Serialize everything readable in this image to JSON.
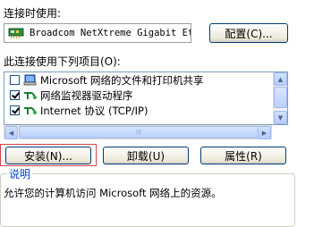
{
  "connect_using": {
    "label": "连接时使用:",
    "adapter_name": "Broadcom NetXtreme Gigabit Eth",
    "adapter_icon": "network-card-icon",
    "configure_button": "配置(C)..."
  },
  "components": {
    "label": "此连接使用下列项目(O):",
    "items": [
      {
        "label": "Microsoft 网络的文件和打印机共享",
        "checked": false,
        "icon": "file-printer-sharing-icon"
      },
      {
        "label": "网络监视器驱动程序",
        "checked": true,
        "icon": "network-protocol-icon"
      },
      {
        "label": "Internet 协议 (TCP/IP)",
        "checked": true,
        "icon": "network-protocol-icon"
      }
    ]
  },
  "scrollbar": {
    "up_arrow": "▲",
    "down_arrow": "▼",
    "left_arrow": "◀",
    "right_arrow": "▶",
    "thumb_grip": "III"
  },
  "buttons": {
    "install": "安装(N)...",
    "uninstall": "卸载(U)",
    "properties": "属性(R)"
  },
  "description": {
    "title": "说明",
    "text": "允许您的计算机访问 Microsoft 网络上的资源。"
  },
  "colors": {
    "highlight_border": "#d64545",
    "group_title": "#0046d5"
  }
}
